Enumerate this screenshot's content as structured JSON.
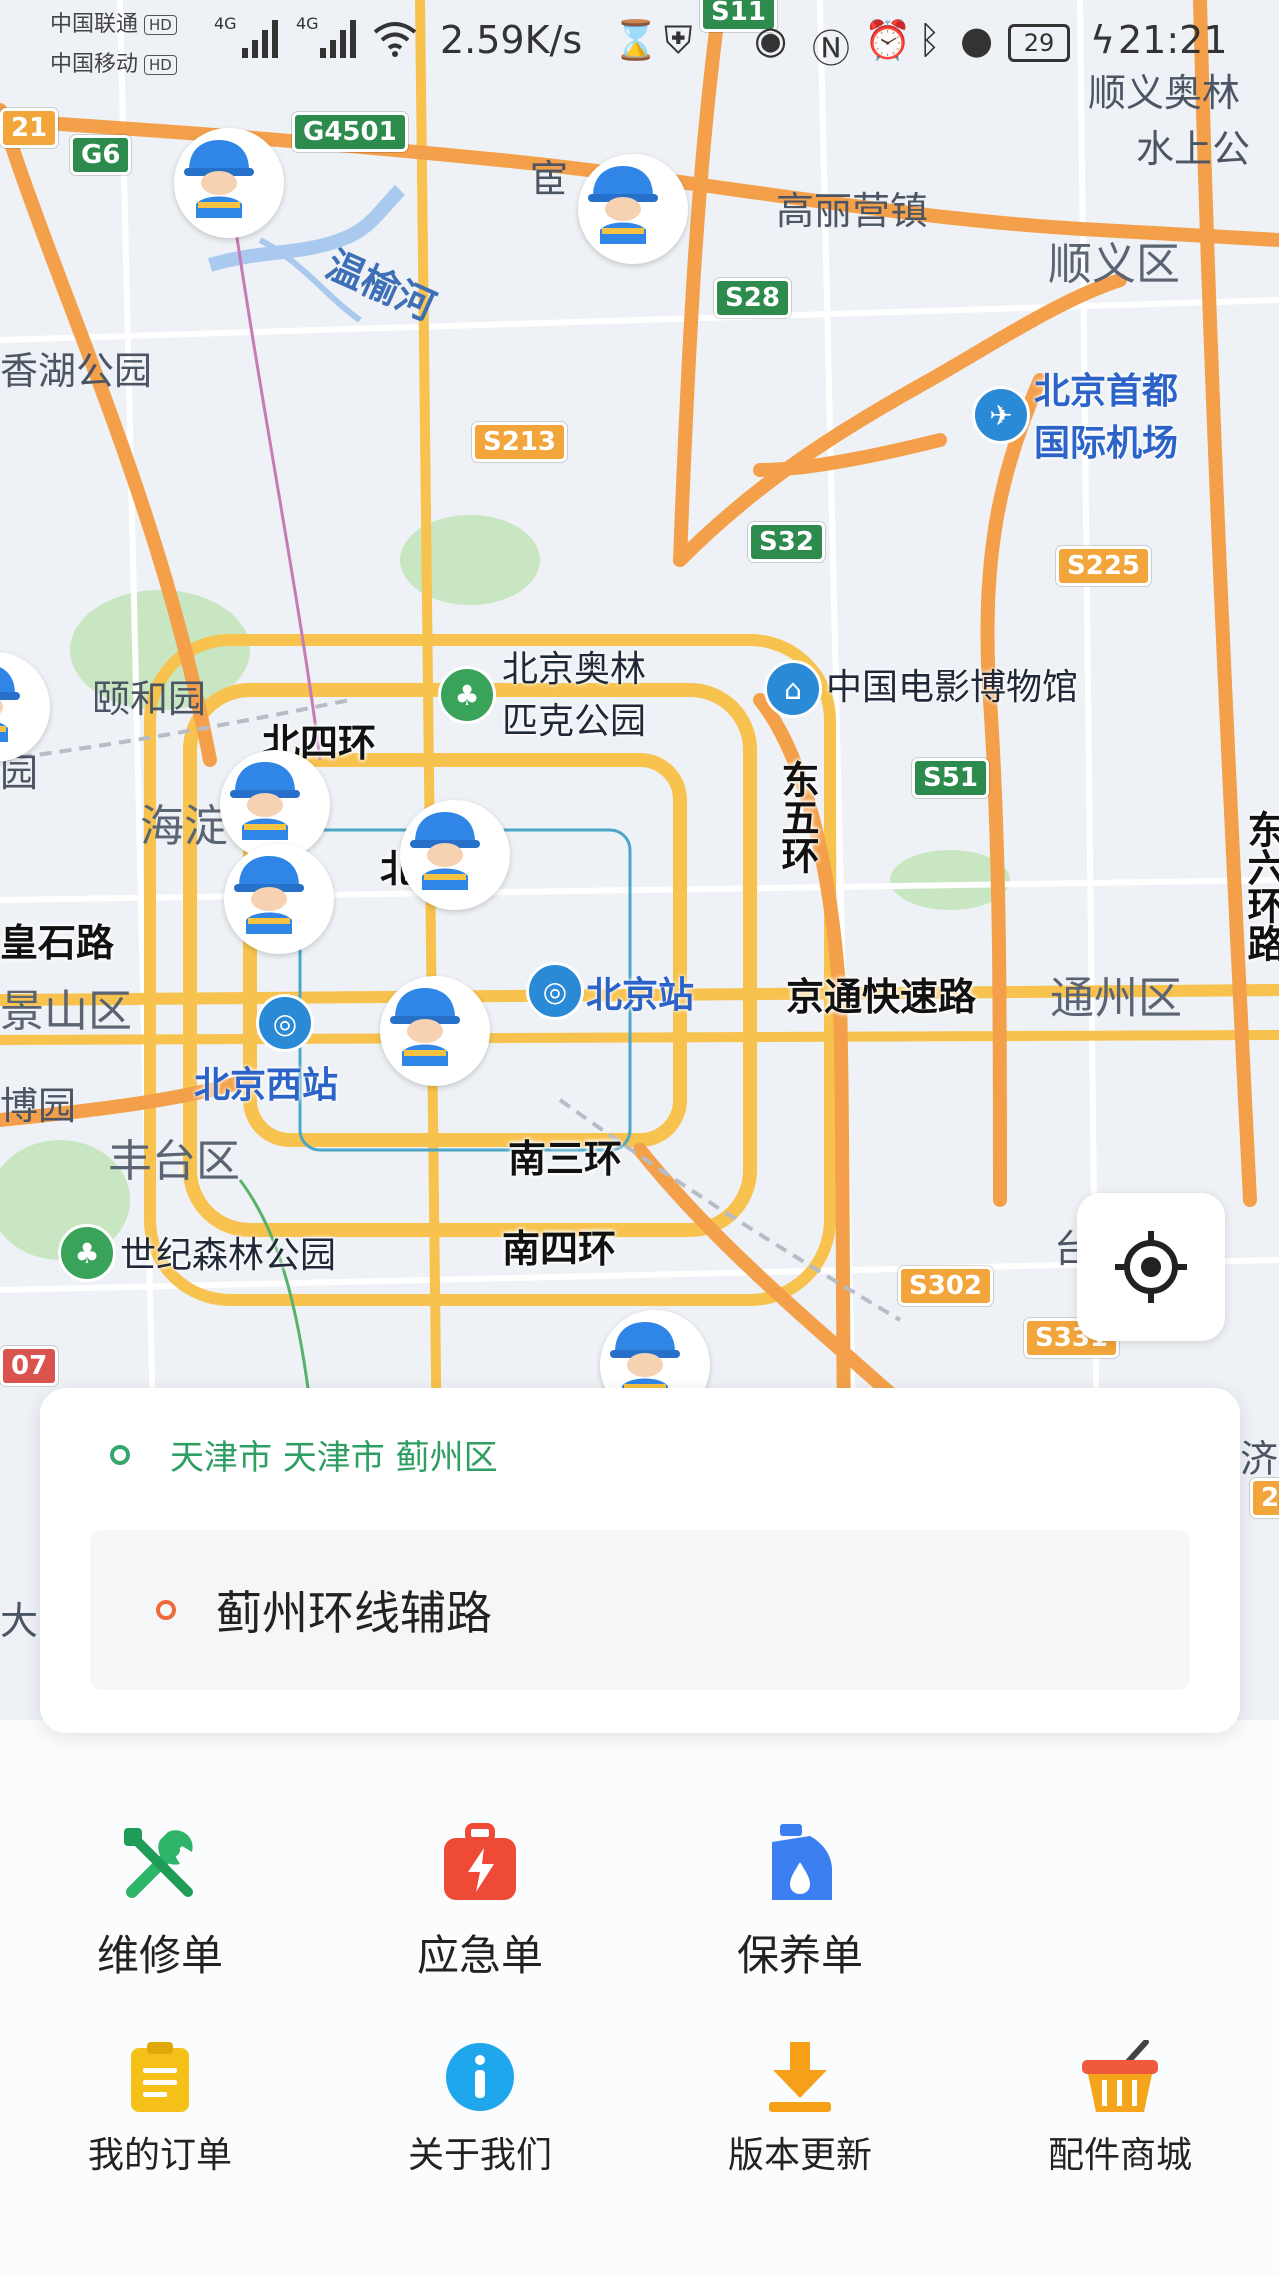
{
  "status_bar": {
    "carrier_1": "中国联通",
    "carrier_2": "中国移动",
    "hd_badge": "HD",
    "net_type": "4G",
    "speed": "2.59K/s",
    "battery": "29",
    "time": "21:21",
    "icons": [
      "signal-icon",
      "wifi-icon",
      "hourglass-icon",
      "shield-icon",
      "eye-icon",
      "nfc-icon",
      "alarm-icon",
      "bluetooth-icon",
      "location-icon",
      "battery-icon",
      "charging-icon"
    ]
  },
  "map": {
    "places": {
      "xiangyuhe": "温榆河",
      "xiangshan_park": "香湖公园",
      "yiheyuan": "颐和园",
      "olympic_park_1": "北京奥林",
      "olympic_park_2": "匹克公园",
      "film_museum": "中国电影博物馆",
      "airport_1": "北京首都",
      "airport_2": "国际机场",
      "beijing_station": "北京站",
      "beijing_west": "北京西站",
      "century_forest_park": "世纪森林公园",
      "gaoliying": "高丽营镇",
      "shunyi_aolin": "顺义奥林",
      "shuishang": "水上公",
      "tan_bao": "博园",
      "huang_road": "皇石路",
      "jing_road_partial": "北",
      "huan_partial": "宦",
      "tai_partial": "台",
      "ji_partial": "济",
      "da_partial": "大",
      "yuan_partial": "园"
    },
    "districts": {
      "shunyi": "顺义区",
      "haidian": "海淀",
      "jingshan": "景山区",
      "fengtai": "丰台区",
      "tongzhou": "通州区"
    },
    "roads": {
      "north_4th_ring": "北四环",
      "east_5th_ring": "东五环",
      "east_6th_ring": "东六环路",
      "jingtong_expressway": "京通快速路",
      "south_3rd_ring": "南三环",
      "south_4th_ring": "南四环"
    },
    "shields": {
      "s11": "S11",
      "g6": "G6",
      "g4501": "G4501",
      "s28": "S28",
      "s213": "S213",
      "s32": "S32",
      "s225": "S225",
      "s51": "S51",
      "s302": "S302",
      "s331": "S331",
      "left_21": "21",
      "left_07": "07",
      "right_2": "2"
    },
    "worker_markers": 8,
    "colors": {
      "ring_road": "#f7c24d",
      "expressway": "#f4a04a",
      "water": "#a9c9ef",
      "park": "#c8e6c2"
    }
  },
  "locate_button": {
    "icon": "crosshair-icon"
  },
  "address": {
    "from": "天津市 天津市 蓟州区",
    "to": "蓟州环线辅路"
  },
  "menu": {
    "row1": [
      {
        "label": "维修单",
        "icon": "wrench-screwdriver-icon",
        "color": "#2fb56a"
      },
      {
        "label": "应急单",
        "icon": "emergency-bag-icon",
        "color": "#ee4a36"
      },
      {
        "label": "保养单",
        "icon": "oil-can-icon",
        "color": "#3b7ff0"
      }
    ],
    "row2": [
      {
        "label": "我的订单",
        "icon": "clipboard-icon",
        "color": "#f5c118"
      },
      {
        "label": "关于我们",
        "icon": "info-icon",
        "color": "#1fa7ee"
      },
      {
        "label": "版本更新",
        "icon": "download-icon",
        "color": "#f5a018"
      },
      {
        "label": "配件商城",
        "icon": "shopping-basket-icon",
        "color": "#ef5b3a"
      }
    ]
  }
}
